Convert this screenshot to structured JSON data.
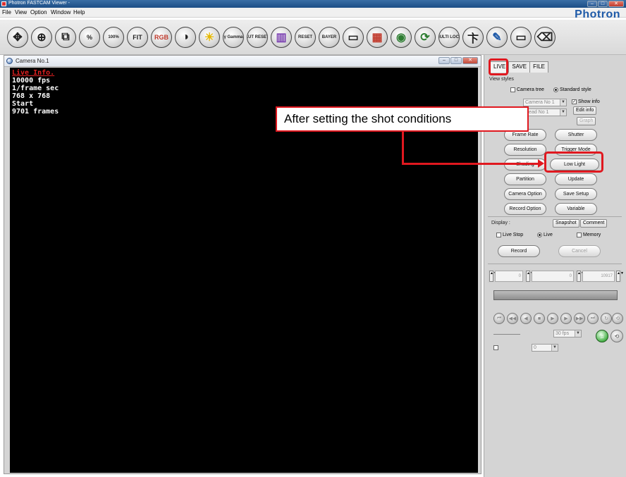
{
  "window": {
    "title": "Photron FASTCAM Viewer -",
    "min": "–",
    "max": "□",
    "close": "✕"
  },
  "menu": {
    "items": [
      "File",
      "View",
      "Option",
      "Window",
      "Help"
    ]
  },
  "brand": "Photron",
  "toolbar": {
    "buttons": [
      {
        "name": "move-tool-button",
        "glyph": "✥"
      },
      {
        "name": "zoom-button",
        "glyph": "⊕"
      },
      {
        "name": "window-fit-button",
        "glyph": "⧉"
      },
      {
        "name": "percent-button",
        "glyph": "%"
      },
      {
        "name": "zoom-100-button",
        "glyph": "100%"
      },
      {
        "name": "fit-button",
        "glyph": "FIT"
      },
      {
        "name": "rgb-button",
        "glyph": "RGB"
      },
      {
        "name": "contrast-button",
        "glyph": "◑"
      },
      {
        "name": "brightness-button",
        "glyph": "☀"
      },
      {
        "name": "gamma-button",
        "glyph": "γ Gamma"
      },
      {
        "name": "lut-reset-button",
        "glyph": "LUT RESET"
      },
      {
        "name": "color-bars-button",
        "glyph": "▥"
      },
      {
        "name": "color-reset-button",
        "glyph": "RESET"
      },
      {
        "name": "bayer-button",
        "glyph": "BAYER"
      },
      {
        "name": "frame-button",
        "glyph": "▭"
      },
      {
        "name": "layout-button",
        "glyph": "▦"
      },
      {
        "name": "capture-button",
        "glyph": "◉"
      },
      {
        "name": "sync-button",
        "glyph": "⟳"
      },
      {
        "name": "multi-lock-button",
        "glyph": "MULTI LOCK"
      },
      {
        "name": "trigger-button",
        "glyph": "卞"
      },
      {
        "name": "pen-button",
        "glyph": "✎"
      },
      {
        "name": "window-button",
        "glyph": "▭"
      },
      {
        "name": "eraser-button",
        "glyph": "⌫"
      }
    ]
  },
  "camera": {
    "title": "Camera No.1",
    "overlay": {
      "live_info": "Live Info.",
      "fps": "10000 fps",
      "shutter": "1/frame sec",
      "resolution": "768 x 768",
      "trigger": "Start",
      "frames": "9701 frames"
    }
  },
  "panel": {
    "tabs": [
      "LIVE",
      "SAVE",
      "FILE"
    ],
    "view_styles_label": "View styles",
    "camera_tree": "Camera tree",
    "standard_style": "Standard style",
    "camera_combo": "Camera No 1",
    "head_combo": "Head No 1",
    "show_info": "Show info",
    "edit_info": "Edit info",
    "graph": "Graph",
    "buttons": {
      "frame_rate": "Frame Rate",
      "shutter": "Shutter",
      "resolution": "Resolution",
      "trigger_mode": "Trigger Mode",
      "shading": "Shading",
      "low_light": "Low Light",
      "partition": "Partition",
      "update": "Update",
      "camera_option": "Camera Option",
      "save_setup": "Save Setup",
      "record_option": "Record Option",
      "variable": "Variable"
    },
    "display_label": "Display :",
    "snapshot": "Snapshot",
    "comment": "Comment",
    "live_stop": "Live Stop",
    "live": "Live",
    "memory": "Memory",
    "record": "Record",
    "cancel": "Cancel",
    "slider": {
      "start": "0",
      "mid": "0",
      "end": "10917"
    },
    "fps_combo": "30 fps",
    "sync_value": "0"
  },
  "annotation": {
    "callout": "After setting the shot conditions"
  },
  "colors": {
    "highlight": "#e0181f",
    "brand": "#1e5aa8",
    "titlebar": "#2a5a94"
  }
}
